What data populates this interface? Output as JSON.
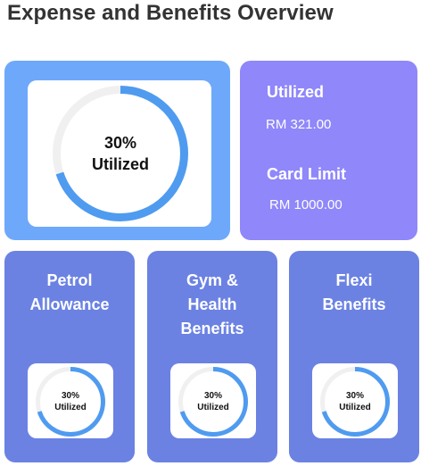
{
  "header": {
    "title": "Expense and Benefits Overview"
  },
  "overview": {
    "progress": {
      "percent": 30,
      "value_text": "30%",
      "label": "Utilized"
    },
    "utilized_label": "Utilized",
    "utilized_value": "RM 321.00",
    "limit_label": "Card Limit",
    "limit_value": "RM 1000.00"
  },
  "benefits": [
    {
      "title_lines": [
        "Petrol",
        "Allowance"
      ],
      "percent": 30,
      "value_text": "30%",
      "label": "Utilized"
    },
    {
      "title_lines": [
        "Gym &",
        "Health",
        "Benefits"
      ],
      "percent": 30,
      "value_text": "30%",
      "label": "Utilized"
    },
    {
      "title_lines": [
        "Flexi",
        "Benefits"
      ],
      "percent": 30,
      "value_text": "30%",
      "label": "Utilized"
    }
  ],
  "colors": {
    "main_card": "#6ea8fa",
    "summary_card": "#8f87fa",
    "benefit_card": "#6b82e3",
    "ring_progress": "#4f9bf0",
    "ring_track": "#f0f0f0"
  }
}
